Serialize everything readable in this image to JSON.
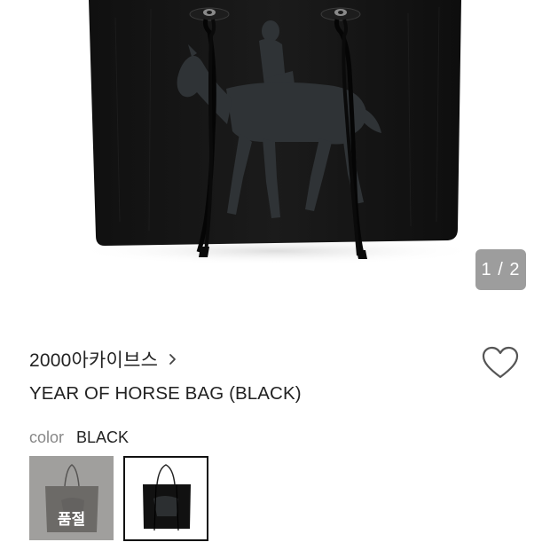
{
  "gallery": {
    "page_indicator": "1 / 2",
    "image_icon": "horse-tote-bag-image"
  },
  "product": {
    "brand": "2000아카이브스",
    "brand_chevron_icon": "chevron-right-icon",
    "title": "YEAR OF HORSE BAG (BLACK)",
    "wishlist_icon": "heart-outline-icon"
  },
  "options": {
    "label": "color",
    "selected_value": "BLACK",
    "swatches": [
      {
        "color_name": "gray",
        "status": "품절",
        "selected": false
      },
      {
        "color_name": "black",
        "status": "",
        "selected": true
      }
    ]
  },
  "colors": {
    "bag_black": "#141414",
    "horse_print": "#2f3336",
    "indicator_bg": "#8c8c8c",
    "selected_border": "#111111"
  }
}
